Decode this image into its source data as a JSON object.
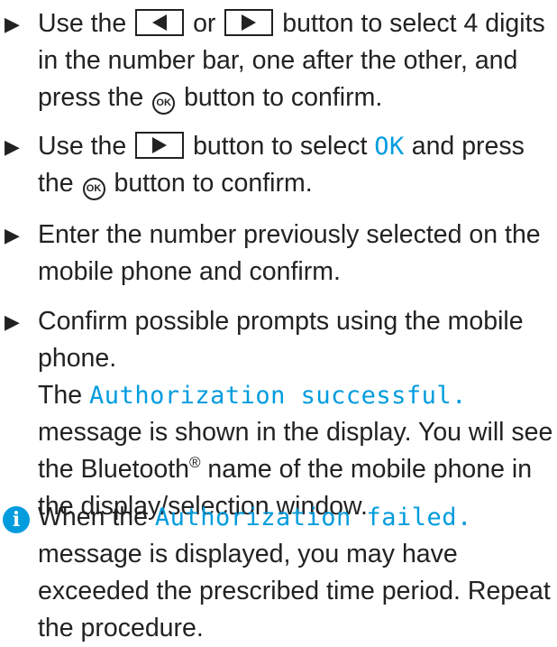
{
  "steps": [
    {
      "bullet": "▶",
      "a": "Use the",
      "left_button_icon": "triangle-left-icon",
      "or": "or",
      "right_button_icon": "triangle-right-icon",
      "b": "button to select 4 digits in the number bar, one after the other, and press the",
      "ok_icon_label": "OK",
      "c": "button to confirm."
    },
    {
      "bullet": "▶",
      "a": "Use the",
      "right_button_icon": "triangle-right-icon",
      "b": "button to select",
      "display_text": "OK",
      "c": "and press the",
      "ok_icon_label": "OK",
      "d": "button to confirm."
    },
    {
      "bullet": "▶",
      "text": "Enter the number previously selected on the mobile phone and confirm."
    },
    {
      "bullet": "▶",
      "text": "Confirm possible prompts using the mobile phone.",
      "result_a": "The",
      "display_text": "Authorization successful.",
      "result_b": "message is shown in the display. You will see the Bluetooth",
      "registered": "®",
      "result_c": "name of the mobile phone in the display/selection window."
    }
  ],
  "info": {
    "icon": "info-icon",
    "icon_glyph": "i",
    "a": "When the",
    "display_text": "Authorization failed.",
    "b": "message is displayed, you may have exceeded the prescribed time period. Repeat the procedure."
  },
  "colors": {
    "display_text": "#009cde",
    "info_icon": "#009cde",
    "body_text": "#222222"
  }
}
